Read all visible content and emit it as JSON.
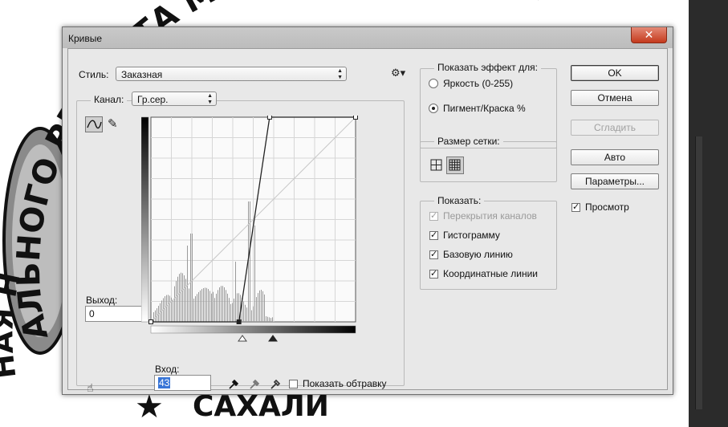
{
  "stamp": {
    "top_text": "АЛЬНОГО РЕМОНТА МНОГОКВАРТИРНЫ",
    "bottom_text": "САХАЛИ",
    "left_text": "НАЯ Н"
  },
  "dialog": {
    "title": "Кривые",
    "close_glyph": "✕",
    "style_label": "Стиль:",
    "style_value": "Заказная",
    "channel_label": "Канал:",
    "channel_value": "Гр.сер.",
    "output_label": "Выход:",
    "output_value": "0",
    "input_label": "Вход:",
    "input_value": "43",
    "show_clipping_label": "Показать обтравку",
    "show_effect": {
      "title": "Показать эффект для:",
      "options": [
        "Яркость (0-255)",
        "Пигмент/Краска %"
      ],
      "selected": 1
    },
    "grid_size": {
      "title": "Размер сетки:"
    },
    "show": {
      "title": "Показать:",
      "items": [
        {
          "label": "Перекрытия каналов",
          "checked": true,
          "disabled": true
        },
        {
          "label": "Гистограмму",
          "checked": true,
          "disabled": false
        },
        {
          "label": "Базовую линию",
          "checked": true,
          "disabled": false
        },
        {
          "label": "Координатные линии",
          "checked": true,
          "disabled": false
        }
      ]
    },
    "buttons": {
      "ok": "OK",
      "cancel": "Отмена",
      "smooth": "Сгладить",
      "auto": "Авто",
      "options": "Параметры..."
    },
    "preview_label": "Просмотр",
    "preview_checked": true
  },
  "curve": {
    "points_in_out": [
      [
        0,
        0
      ],
      [
        43,
        0
      ],
      [
        58,
        100
      ],
      [
        100,
        100
      ]
    ],
    "input_range": [
      0,
      100
    ],
    "output_range": [
      0,
      100
    ]
  },
  "icons": {
    "settings": "gear-icon",
    "curve_tool": "curve-tool-icon",
    "pencil_tool": "pencil-icon",
    "hand_tool": "hand-adjust-icon",
    "eyedropper_black": "eyedropper-black-icon",
    "eyedropper_gray": "eyedropper-gray-icon",
    "eyedropper_white": "eyedropper-white-icon",
    "grid_simple": "grid-simple-icon",
    "grid_detailed": "grid-detailed-icon"
  }
}
